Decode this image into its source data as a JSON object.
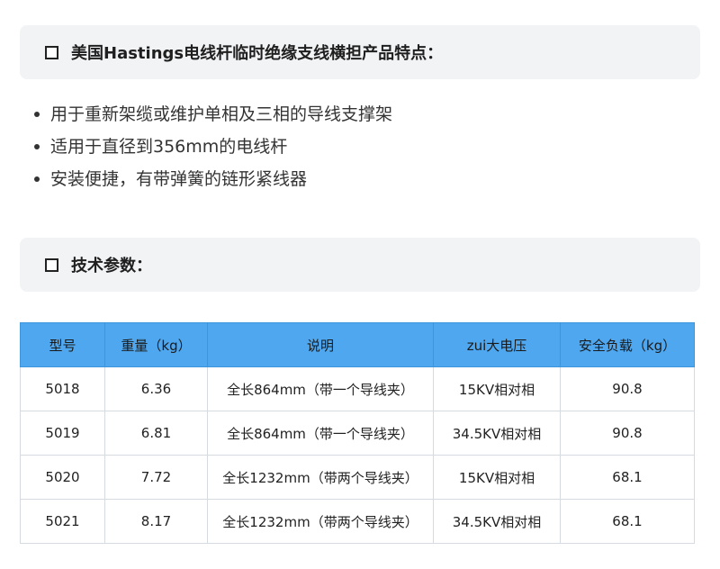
{
  "section1": {
    "title": "美国Hastings电线杆临时绝缘支线横担产品特点："
  },
  "features": [
    "用于重新架缆或维护单相及三相的导线支撑架",
    "适用于直径到356mm的电线杆",
    "安装便捷，有带弹簧的链形紧线器"
  ],
  "section2": {
    "title": "技术参数："
  },
  "table": {
    "headers": [
      "型号",
      "重量（kg）",
      "说明",
      "zui大电压",
      "安全负载（kg）"
    ],
    "rows": [
      [
        "5018",
        "6.36",
        "全长864mm（带一个导线夹）",
        "15KV相对相",
        "90.8"
      ],
      [
        "5019",
        "6.81",
        "全长864mm（带一个导线夹）",
        "34.5KV相对相",
        "90.8"
      ],
      [
        "5020",
        "7.72",
        "全长1232mm（带两个导线夹）",
        "15KV相对相",
        "68.1"
      ],
      [
        "5021",
        "8.17",
        "全长1232mm（带两个导线夹）",
        "34.5KV相对相",
        "68.1"
      ]
    ],
    "header_color": "#4fa8ef"
  }
}
